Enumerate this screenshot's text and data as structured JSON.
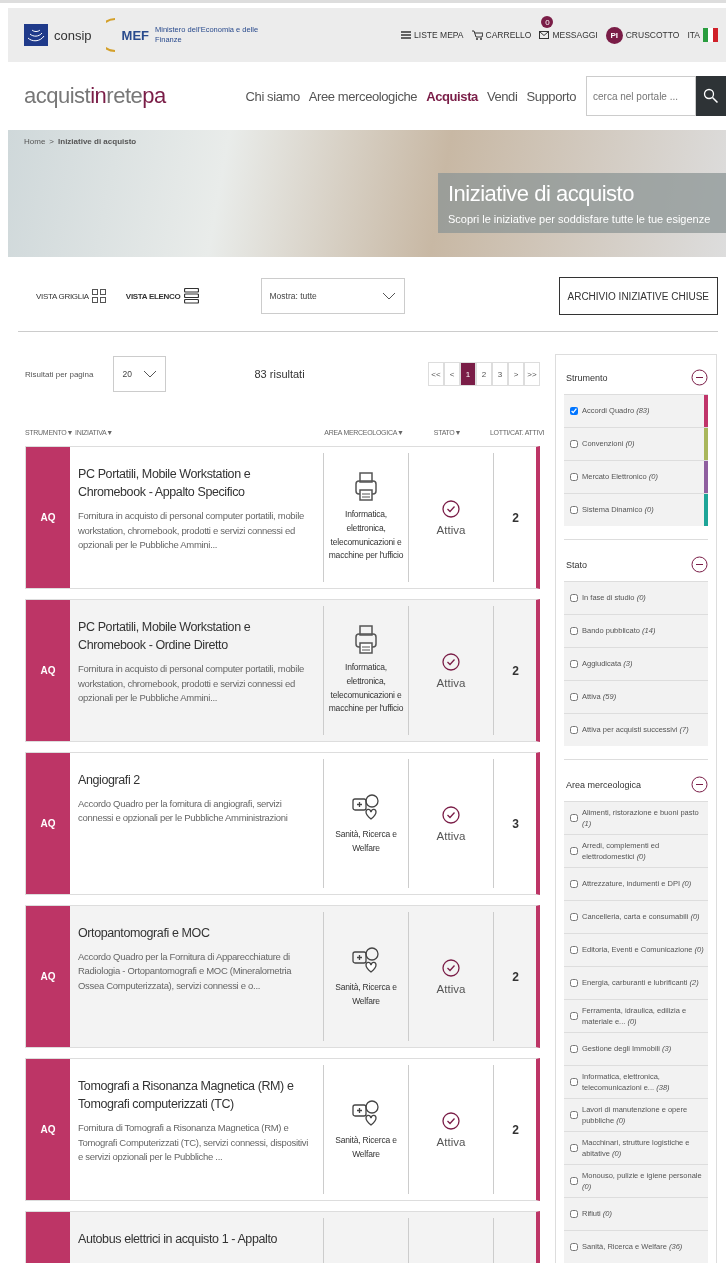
{
  "top_bar": {
    "consip": "consip",
    "mef": "MEF",
    "mef_name": "Ministero dell'Economia e delle Finanze",
    "links": [
      {
        "kind": "menu",
        "label": "LISTE MEPA"
      },
      {
        "kind": "cart",
        "label": "CARRELLO"
      },
      {
        "kind": "mail",
        "label": "MESSAGGI",
        "badge": "0"
      },
      {
        "kind": "avatar",
        "label": "CRUSCOTTO",
        "initials": "PI"
      },
      {
        "kind": "flag",
        "label": "ITA"
      }
    ]
  },
  "logo": [
    {
      "text": "acquist",
      "accent": false
    },
    {
      "text": "in",
      "accent": true
    },
    {
      "text": "rete",
      "accent": false
    },
    {
      "text": "pa",
      "accent": true
    }
  ],
  "nav": [
    {
      "label": "Chi siamo",
      "selected": false
    },
    {
      "label": "Aree merceologiche",
      "selected": false
    },
    {
      "label": "Acquista",
      "selected": true
    },
    {
      "label": "Vendi",
      "selected": false
    },
    {
      "label": "Supporto",
      "selected": false
    }
  ],
  "search": {
    "placeholder": "cerca nel portale ..."
  },
  "breadcrumb": [
    {
      "label": "Home",
      "current": false
    },
    {
      "label": ">",
      "current": false
    },
    {
      "label": "Iniziative di acquisto",
      "current": true
    }
  ],
  "hero": {
    "title": "Iniziative di acquisto",
    "subtitle": "Scopri le iniziative per soddisfare tutte le tue esigenze"
  },
  "views": [
    {
      "label": "VISTA GRIGLIA",
      "kind": "grid",
      "selected": false
    },
    {
      "label": "VISTA ELENCO",
      "kind": "list",
      "selected": true
    }
  ],
  "filter_select": {
    "value": "Mostra: tutte"
  },
  "archive_button": "ARCHIVIO INIZIATIVE CHIUSE",
  "per_page": {
    "label": "Risultati per pagina",
    "value": "20"
  },
  "results": "83 risultati",
  "pagination": [
    {
      "label": "<<",
      "selected": false
    },
    {
      "label": "<",
      "selected": false
    },
    {
      "label": "1",
      "selected": true
    },
    {
      "label": "2",
      "selected": false
    },
    {
      "label": "3",
      "selected": false
    },
    {
      "label": ">",
      "selected": false
    },
    {
      "label": ">>",
      "selected": false
    }
  ],
  "columns": [
    "STRUMENTO▼",
    "INIZIATIVA▼",
    "AREA MERCEOLOGICA▼",
    "STATO▼",
    "LOTTI/CAT. ATTIVI"
  ],
  "rows": [
    {
      "badge": "AQ",
      "title": "PC Portatili, Mobile Workstation e Chromebook - Appalto Specifico",
      "description": "Fornitura in acquisto di personal computer portatili, mobile workstation, chromebook, prodotti e servizi connessi ed opzionali per le Pubbliche Ammini...",
      "area": "Informatica, elettronica, telecomunicazioni e macchine per l'ufficio",
      "kind": "printer",
      "status": "Attiva",
      "lots": "2",
      "color": "#bd3566"
    },
    {
      "badge": "AQ",
      "title": "PC Portatili, Mobile Workstation e Chromebook - Ordine Diretto",
      "description": "Fornitura in acquisto di personal computer portatili, mobile workstation, chromebook, prodotti e servizi connessi ed opzionali per le Pubbliche Ammini...",
      "area": "Informatica, elettronica, telecomunicazioni e macchine per l'ufficio",
      "kind": "printer",
      "status": "Attiva",
      "lots": "2",
      "color": "#bd3566"
    },
    {
      "badge": "AQ",
      "title": "Angiografi 2",
      "description": "Accordo Quadro per la fornitura di angiografi, servizi connessi e opzionali per le Pubbliche Amministrazioni",
      "area": "Sanità, Ricerca e Welfare",
      "kind": "health",
      "status": "Attiva",
      "lots": "3",
      "color": "#bd3566"
    },
    {
      "badge": "AQ",
      "title": "Ortopantomografi e MOC",
      "description": "Accordo Quadro per la Fornitura di Apparecchiature di Radiologia -  Ortopantomografi e MOC (Mineralometria Ossea Computerizzata), servizi connessi e o...",
      "area": "Sanità, Ricerca e Welfare",
      "kind": "health",
      "status": "Attiva",
      "lots": "2",
      "color": "#bd3566"
    },
    {
      "badge": "AQ",
      "title": "Tomografi a Risonanza Magnetica (RM) e Tomografi computerizzati (TC)",
      "description": "Fornitura di Tomografi a Risonanza Magnetica (RM) e Tomografi Computerizzati (TC), servizi connessi, dispositivi e servizi opzionali per le Pubbliche ...",
      "area": "Sanità, Ricerca e Welfare",
      "kind": "health",
      "status": "Attiva",
      "lots": "2",
      "color": "#bd3566"
    },
    {
      "badge": "",
      "title": "Autobus elettrici in acquisto 1 - Appalto",
      "kind": "bus",
      "color": "#bd3566"
    }
  ],
  "filters": [
    {
      "title": "Strumento",
      "items": [
        {
          "label": "Accordi Quadro",
          "count": "(83)",
          "checked": true,
          "color": "#c0356a"
        },
        {
          "label": "Convenzioni",
          "count": "(0)",
          "checked": false,
          "color": "#a9b75c"
        },
        {
          "label": "Mercato Elettronico",
          "count": "(0)",
          "checked": false,
          "color": "#8f5f9f"
        },
        {
          "label": "Sistema Dinamico",
          "count": "(0)",
          "checked": false,
          "color": "#1ea598"
        }
      ]
    },
    {
      "title": "Stato",
      "items": [
        {
          "label": "In fase di studio",
          "count": "(0)",
          "checked": false
        },
        {
          "label": "Bando pubblicato",
          "count": "(14)",
          "checked": false
        },
        {
          "label": "Aggiudicata",
          "count": "(3)",
          "checked": false
        },
        {
          "label": "Attiva",
          "count": "(59)",
          "checked": false
        },
        {
          "label": "Attiva per acquisti successivi",
          "count": "(7)",
          "checked": false
        }
      ]
    },
    {
      "title": "Area merceologica",
      "items": [
        {
          "label": "Alimenti, ristorazione e buoni pasto",
          "count": "(1)",
          "checked": false
        },
        {
          "label": "Arredi, complementi ed elettrodomestici",
          "count": "(0)",
          "checked": false
        },
        {
          "label": "Attrezzature, indumenti e DPI",
          "count": "(0)",
          "checked": false
        },
        {
          "label": "Cancelleria, carta e consumabili",
          "count": "(0)",
          "checked": false
        },
        {
          "label": "Editoria, Eventi e Comunicazione",
          "count": "(0)",
          "checked": false
        },
        {
          "label": "Energia, carburanti e lubrificanti",
          "count": "(2)",
          "checked": false
        },
        {
          "label": "Ferramenta, idraulica, edilizia e materiale e...",
          "count": "(0)",
          "checked": false
        },
        {
          "label": "Gestione degli Immobili",
          "count": "(3)",
          "checked": false
        },
        {
          "label": "Informatica, elettronica, telecomunicazioni e...",
          "count": "(38)",
          "checked": false
        },
        {
          "label": "Lavori di manutenzione e opere pubbliche",
          "count": "(0)",
          "checked": false
        },
        {
          "label": "Macchinari, strutture logistiche e abitative",
          "count": "(0)",
          "checked": false
        },
        {
          "label": "Monouso, pulizie e igiene personale",
          "count": "(0)",
          "checked": false
        },
        {
          "label": "Rifiuti",
          "count": "(0)",
          "checked": false
        },
        {
          "label": "Sanità, Ricerca e Welfare",
          "count": "(36)",
          "checked": false
        }
      ]
    }
  ]
}
